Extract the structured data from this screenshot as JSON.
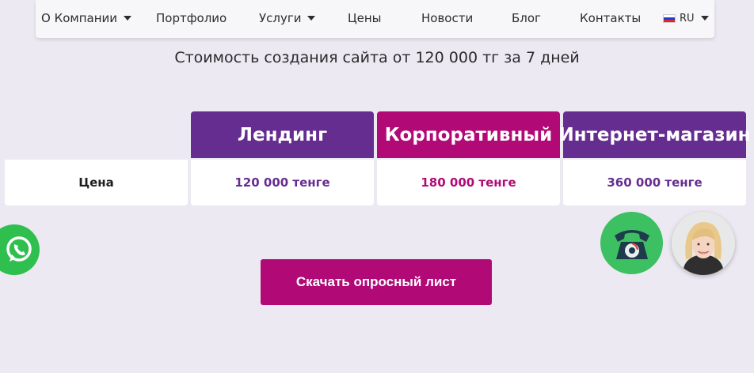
{
  "nav": {
    "items": [
      {
        "label": "О Компании",
        "dropdown": true
      },
      {
        "label": "Портфолио",
        "dropdown": false
      },
      {
        "label": "Услуги",
        "dropdown": true
      },
      {
        "label": "Цены",
        "dropdown": false
      },
      {
        "label": "Новости",
        "dropdown": false
      },
      {
        "label": "Блог",
        "dropdown": false
      },
      {
        "label": "Контакты",
        "dropdown": false
      }
    ],
    "language": {
      "label": "RU",
      "flag_icon": "russia-flag-icon"
    }
  },
  "subtitle": "Стоимость создания сайта от 120 000 тг за 7 дней",
  "pricing": {
    "row_label": "Цена",
    "plans": [
      {
        "name": "Лендинг",
        "price": "120 000 тенге",
        "color": "#662d91"
      },
      {
        "name": "Корпоративный",
        "price": "180 000 тенге",
        "color": "#b10a76"
      },
      {
        "name": "Интернет-магазин",
        "price": "360 000 тенге",
        "color": "#662d91"
      }
    ]
  },
  "cta": {
    "label": "Скачать опросный лист",
    "color": "#b10a76"
  },
  "widgets": {
    "whatsapp_icon": "whatsapp-icon",
    "phone_icon": "phone-icon",
    "avatar_icon": "consultant-avatar"
  }
}
